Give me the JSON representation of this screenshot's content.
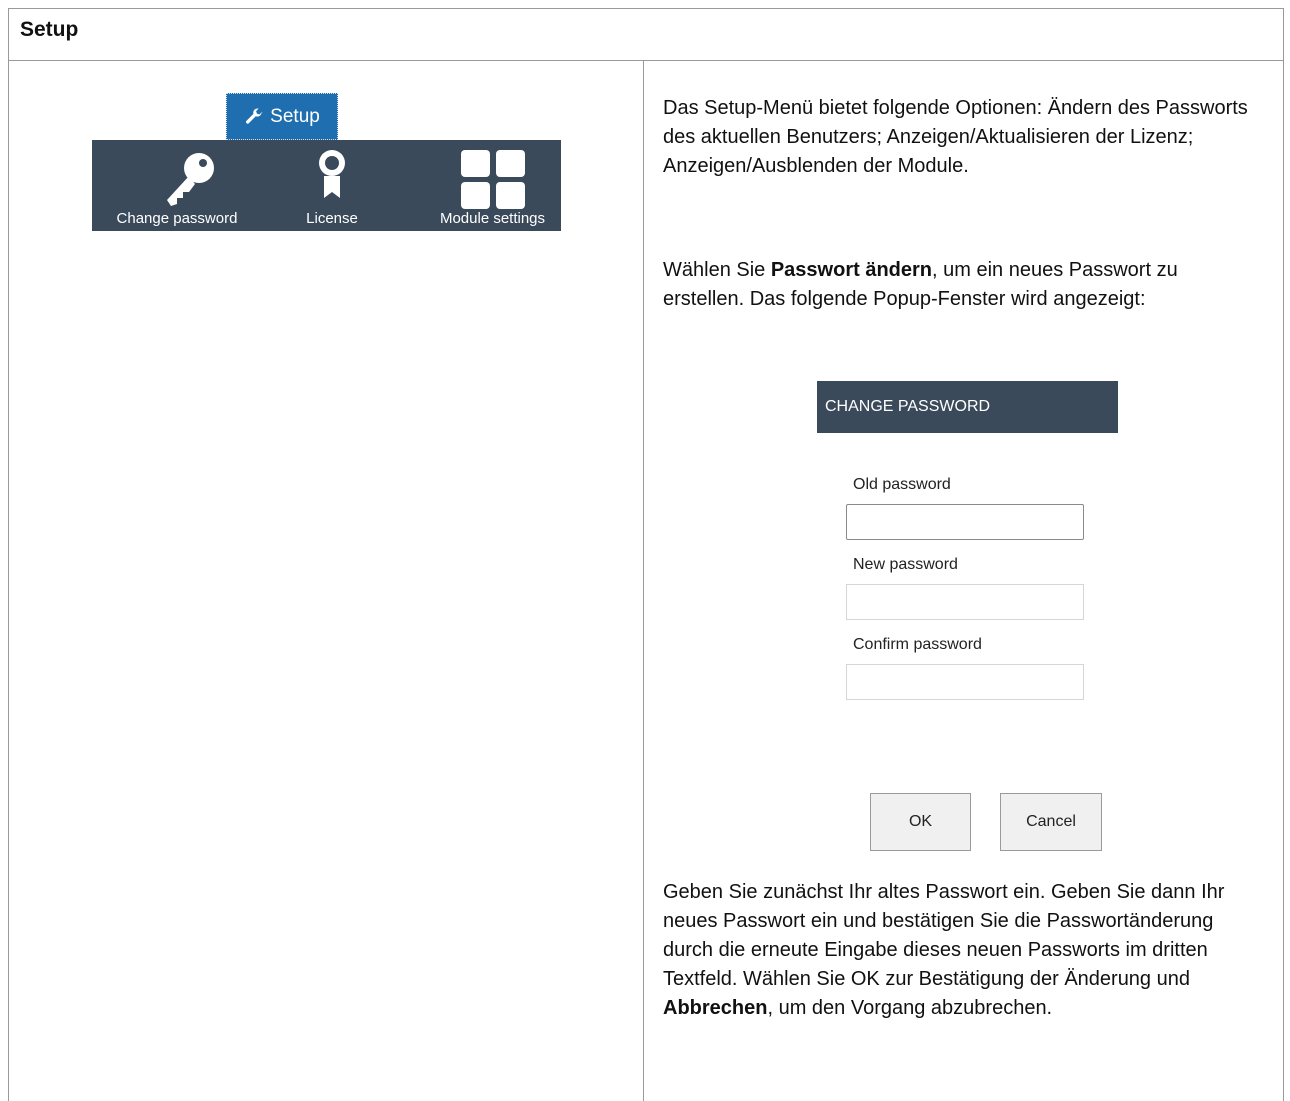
{
  "section": {
    "title": "Setup"
  },
  "setup_ui": {
    "tab_label": "Setup",
    "tab_icon": "wrench-icon",
    "items": [
      {
        "label": "Change password",
        "icon": "key-icon"
      },
      {
        "label": "License",
        "icon": "award-ribbon-icon"
      },
      {
        "label": "Module settings",
        "icon": "grid-icon"
      }
    ],
    "ribbon_color": "#3b4a5b",
    "tab_color": "#1f6fb0"
  },
  "description": {
    "intro": "Das Setup-Menü bietet folgende Optionen: Ändern des Passworts des aktuellen Benutzers; Anzeigen/Aktualisieren der Lizenz; Anzeigen/Ausblenden der Module.",
    "select_prefix": "Wählen Sie ",
    "select_bold": "Passwort ändern",
    "select_suffix": ", um ein neues Passwort zu erstellen. Das folgende Popup-Fenster wird angezeigt:",
    "instructions": "Geben Sie zunächst Ihr altes Passwort ein. Geben Sie dann Ihr neues Passwort ein und bestätigen Sie die Passwortänderung durch die erneute Eingabe dieses neuen Passworts im dritten Textfeld. Wählen Sie OK zur Bestätigung der Änderung und ",
    "cancel_bold": "Abbrechen",
    "closing": ", um den Vorgang abzubrechen."
  },
  "dialog": {
    "title": "CHANGE PASSWORD",
    "old_label": "Old password",
    "old_value": "",
    "new_label": "New password",
    "new_value": "",
    "confirm_label": "Confirm password",
    "confirm_value": "",
    "ok_label": "OK",
    "cancel_label": "Cancel"
  }
}
